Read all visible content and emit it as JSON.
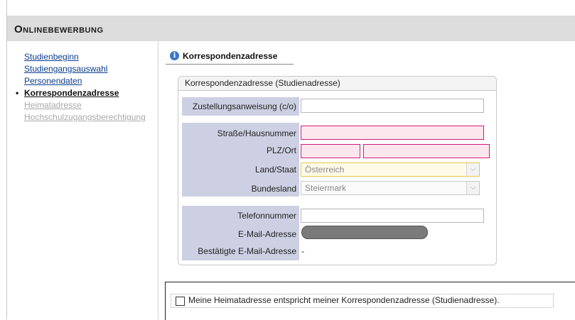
{
  "app": {
    "title": "Onlinebewerbung"
  },
  "nav": {
    "items": [
      {
        "label": "Studienbeginn"
      },
      {
        "label": "Studiengangsauswahl"
      },
      {
        "label": "Personendaten"
      },
      {
        "label": "Korrespondenzadresse"
      },
      {
        "label": "Heimatadresse"
      },
      {
        "label": "Hochschulzugangsberechtigung"
      }
    ],
    "bullet": "•"
  },
  "main": {
    "title": "Korrespondenzadresse",
    "info_icon": "info-icon"
  },
  "form": {
    "group_title": "Korrespondenzadresse (Studienadresse)",
    "zustellung": {
      "label": "Zustellungsanweisung (c/o)",
      "value": ""
    },
    "strasse": {
      "label": "Straße/Hausnummer",
      "value": ""
    },
    "plzort": {
      "label": "PLZ/Ort",
      "plz_value": "",
      "ort_value": ""
    },
    "land": {
      "label": "Land/Staat",
      "value": "Österreich"
    },
    "bundesland": {
      "label": "Bundesland",
      "value": "Steiermark"
    },
    "telefon": {
      "label": "Telefonnummer",
      "value": ""
    },
    "email": {
      "label": "E-Mail-Adresse"
    },
    "email_confirmed": {
      "label": "Bestätigte E-Mail-Adresse",
      "value": "-"
    },
    "arrow": "⌵"
  },
  "checkbox": {
    "label": "Meine Heimatadresse entspricht meiner Korrespondenzadresse (Studienadresse).",
    "checked": false
  },
  "colors": {
    "error_border": "#d11a7a",
    "label_bg": "#cdd0e3",
    "header_band": "#dcdcdc",
    "link": "#0b3c8c"
  }
}
